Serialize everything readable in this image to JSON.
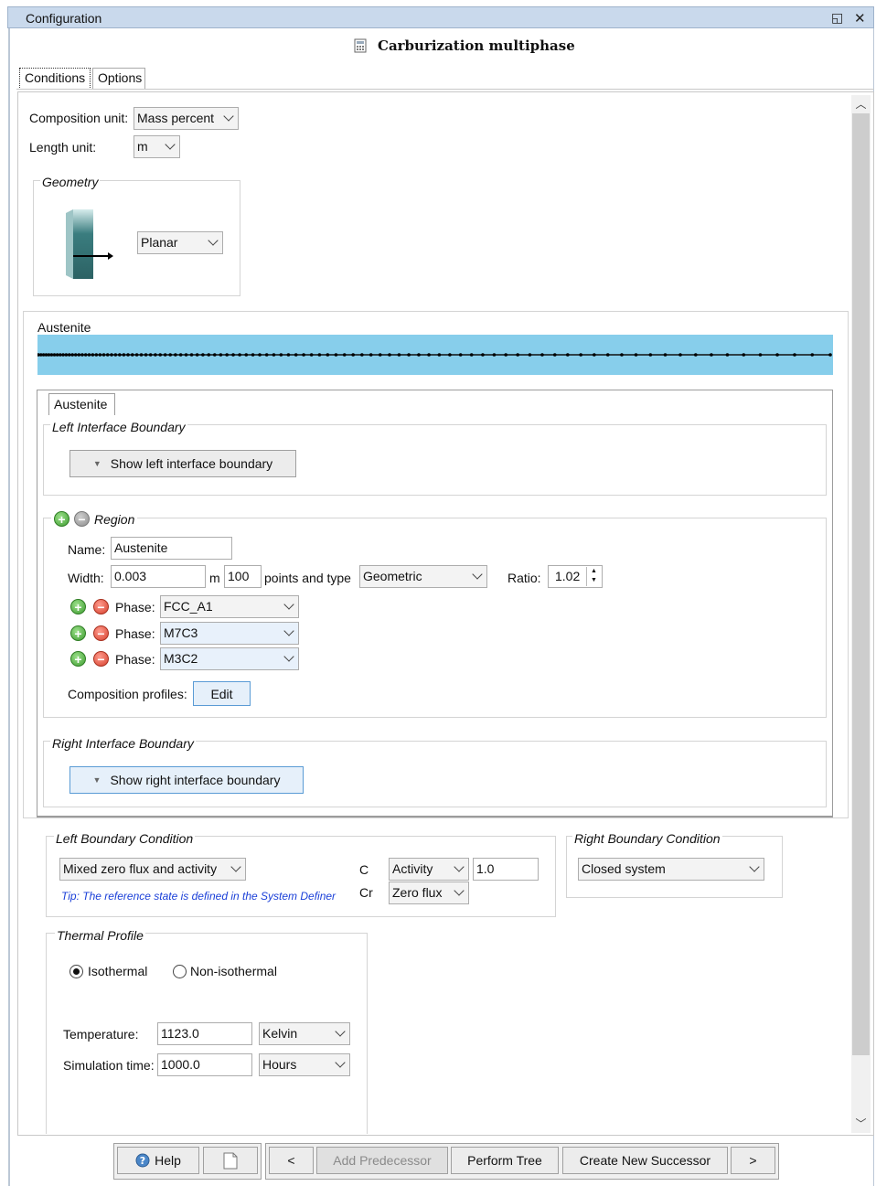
{
  "window": {
    "title": "Configuration"
  },
  "header": {
    "title": "Carburization multiphase"
  },
  "tabs": [
    {
      "label": "Conditions"
    },
    {
      "label": "Options"
    }
  ],
  "units": {
    "composition_label": "Composition unit:",
    "composition_value": "Mass percent",
    "length_label": "Length unit:",
    "length_value": "m"
  },
  "geometry": {
    "label": "Geometry",
    "value": "Planar"
  },
  "region_preview": {
    "label": "Austenite",
    "bar_color": "#87ceeb"
  },
  "region_tab": {
    "label": "Austenite"
  },
  "left_interface": {
    "label": "Left Interface Boundary",
    "button": "Show left interface boundary"
  },
  "region": {
    "label": "Region",
    "name_label": "Name:",
    "name_value": "Austenite",
    "width_label": "Width:",
    "width_value": "0.003",
    "width_unit": "m",
    "points_value": "100",
    "points_label": "points and type",
    "type_value": "Geometric",
    "ratio_label": "Ratio:",
    "ratio_value": "1.02",
    "phase_label": "Phase:",
    "phases": [
      "FCC_A1",
      "M7C3",
      "M3C2"
    ],
    "composition_label": "Composition profiles:",
    "edit_button": "Edit"
  },
  "right_interface": {
    "label": "Right Interface Boundary",
    "button": "Show right interface boundary"
  },
  "left_boundary": {
    "label": "Left Boundary Condition",
    "type": "Mixed zero flux and activity",
    "tip": "Tip: The reference state is defined in the System Definer",
    "elements": [
      {
        "name": "C",
        "condition": "Activity",
        "value": "1.0"
      },
      {
        "name": "Cr",
        "condition": "Zero flux"
      }
    ]
  },
  "right_boundary": {
    "label": "Right Boundary Condition",
    "type": "Closed system"
  },
  "thermal": {
    "label": "Thermal Profile",
    "isothermal": "Isothermal",
    "non_isothermal": "Non-isothermal",
    "temperature_label": "Temperature:",
    "temperature_value": "1123.0",
    "temperature_unit": "Kelvin",
    "time_label": "Simulation time:",
    "time_value": "1000.0",
    "time_unit": "Hours"
  },
  "footer": {
    "help": "Help",
    "prev": "<",
    "add_predecessor": "Add Predecessor",
    "perform_tree": "Perform Tree",
    "create_successor": "Create New Successor",
    "next": ">"
  },
  "icons": {
    "restore": "restore-icon",
    "close": "close-icon",
    "calculator": "calculator-icon",
    "help": "help-icon",
    "document": "document-icon"
  }
}
